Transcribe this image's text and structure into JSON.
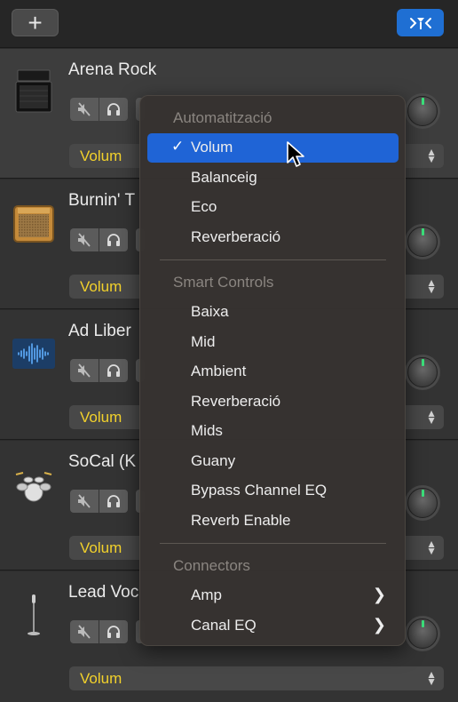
{
  "toolbar": {
    "add_label": "+"
  },
  "tracks": [
    {
      "name": "Arena Rock",
      "automation": "Volum"
    },
    {
      "name": "Burnin' T",
      "automation": "Volum"
    },
    {
      "name": "Ad Liber",
      "automation": "Volum"
    },
    {
      "name": "SoCal (K",
      "automation": "Volum"
    },
    {
      "name": "Lead Voc",
      "automation": "Volum"
    }
  ],
  "menu": {
    "sections": [
      {
        "header": "Automatització",
        "items": [
          "Volum",
          "Balanceig",
          "Eco",
          "Reverberació"
        ]
      },
      {
        "header": "Smart Controls",
        "items": [
          "Baixa",
          "Mid",
          "Ambient",
          "Reverberació",
          "Mids",
          "Guany",
          "Bypass Channel EQ",
          "Reverb Enable"
        ]
      },
      {
        "header": "Connectors",
        "items": [
          "Amp",
          "Canal EQ"
        ]
      }
    ],
    "selected_item": "Volum",
    "check_glyph": "✓",
    "submenu_glyph": "❯"
  },
  "colors": {
    "accent": "#1f64d6",
    "automation_text": "#f2d12b",
    "knob_indicator": "#3be07a"
  }
}
